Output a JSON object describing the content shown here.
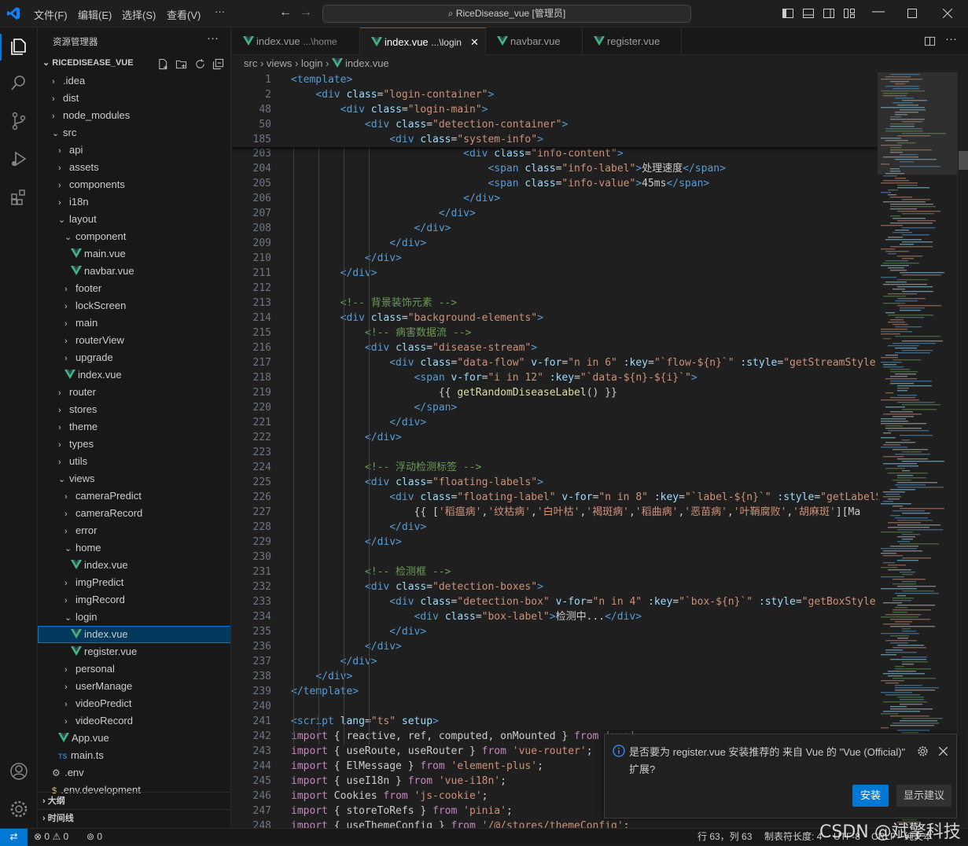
{
  "titlebar": {
    "menus": [
      "文件(F)",
      "编辑(E)",
      "选择(S)",
      "查看(V)",
      "···"
    ],
    "search": "RiceDisease_vue [管理员]"
  },
  "sidebar": {
    "header": "资源管理器",
    "project": "RICEDISEASE_VUE",
    "tree": [
      {
        "label": ".idea",
        "depth": 0,
        "kind": "folder",
        "open": false
      },
      {
        "label": "dist",
        "depth": 0,
        "kind": "folder",
        "open": false
      },
      {
        "label": "node_modules",
        "depth": 0,
        "kind": "folder",
        "open": false
      },
      {
        "label": "src",
        "depth": 0,
        "kind": "folder",
        "open": true
      },
      {
        "label": "api",
        "depth": 1,
        "kind": "folder",
        "open": false
      },
      {
        "label": "assets",
        "depth": 1,
        "kind": "folder",
        "open": false
      },
      {
        "label": "components",
        "depth": 1,
        "kind": "folder",
        "open": false
      },
      {
        "label": "i18n",
        "depth": 1,
        "kind": "folder",
        "open": false
      },
      {
        "label": "layout",
        "depth": 1,
        "kind": "folder",
        "open": true
      },
      {
        "label": "component",
        "depth": 2,
        "kind": "folder",
        "open": true
      },
      {
        "label": "main.vue",
        "depth": 3,
        "kind": "vue"
      },
      {
        "label": "navbar.vue",
        "depth": 3,
        "kind": "vue"
      },
      {
        "label": "footer",
        "depth": 2,
        "kind": "folder",
        "open": false
      },
      {
        "label": "lockScreen",
        "depth": 2,
        "kind": "folder",
        "open": false
      },
      {
        "label": "main",
        "depth": 2,
        "kind": "folder",
        "open": false
      },
      {
        "label": "routerView",
        "depth": 2,
        "kind": "folder",
        "open": false
      },
      {
        "label": "upgrade",
        "depth": 2,
        "kind": "folder",
        "open": false
      },
      {
        "label": "index.vue",
        "depth": 2,
        "kind": "vue"
      },
      {
        "label": "router",
        "depth": 1,
        "kind": "folder",
        "open": false
      },
      {
        "label": "stores",
        "depth": 1,
        "kind": "folder",
        "open": false
      },
      {
        "label": "theme",
        "depth": 1,
        "kind": "folder",
        "open": false
      },
      {
        "label": "types",
        "depth": 1,
        "kind": "folder",
        "open": false
      },
      {
        "label": "utils",
        "depth": 1,
        "kind": "folder",
        "open": false
      },
      {
        "label": "views",
        "depth": 1,
        "kind": "folder",
        "open": true
      },
      {
        "label": "cameraPredict",
        "depth": 2,
        "kind": "folder",
        "open": false
      },
      {
        "label": "cameraRecord",
        "depth": 2,
        "kind": "folder",
        "open": false
      },
      {
        "label": "error",
        "depth": 2,
        "kind": "folder",
        "open": false
      },
      {
        "label": "home",
        "depth": 2,
        "kind": "folder",
        "open": true
      },
      {
        "label": "index.vue",
        "depth": 3,
        "kind": "vue"
      },
      {
        "label": "imgPredict",
        "depth": 2,
        "kind": "folder",
        "open": false
      },
      {
        "label": "imgRecord",
        "depth": 2,
        "kind": "folder",
        "open": false
      },
      {
        "label": "login",
        "depth": 2,
        "kind": "folder",
        "open": true
      },
      {
        "label": "index.vue",
        "depth": 3,
        "kind": "vue",
        "selected": true
      },
      {
        "label": "register.vue",
        "depth": 3,
        "kind": "vue"
      },
      {
        "label": "personal",
        "depth": 2,
        "kind": "folder",
        "open": false
      },
      {
        "label": "userManage",
        "depth": 2,
        "kind": "folder",
        "open": false
      },
      {
        "label": "videoPredict",
        "depth": 2,
        "kind": "folder",
        "open": false
      },
      {
        "label": "videoRecord",
        "depth": 2,
        "kind": "folder",
        "open": false
      },
      {
        "label": "App.vue",
        "depth": 1,
        "kind": "vue"
      },
      {
        "label": "main.ts",
        "depth": 1,
        "kind": "ts"
      },
      {
        "label": ".env",
        "depth": 0,
        "kind": "gear"
      },
      {
        "label": ".env.development",
        "depth": 0,
        "kind": "env"
      }
    ],
    "sections": [
      "大纲",
      "时间线"
    ]
  },
  "tabs": [
    {
      "label": "index.vue",
      "hint": "...\\home",
      "active": false
    },
    {
      "label": "index.vue",
      "hint": "...\\login",
      "active": true
    },
    {
      "label": "navbar.vue",
      "hint": "",
      "active": false
    },
    {
      "label": "register.vue",
      "hint": "",
      "active": false
    }
  ],
  "breadcrumb": [
    "src",
    "views",
    "login",
    "index.vue"
  ],
  "sticky_lines": [
    {
      "n": "1",
      "html": "<span class='tag'>&lt;template&gt;</span>"
    },
    {
      "n": "2",
      "html": "    <span class='tag'>&lt;div</span> <span class='attr'>class</span>=<span class='str'>\"login-container\"</span><span class='tag'>&gt;</span>"
    },
    {
      "n": "48",
      "html": "        <span class='tag'>&lt;div</span> <span class='attr'>class</span>=<span class='str'>\"login-main\"</span><span class='tag'>&gt;</span>"
    },
    {
      "n": "50",
      "html": "            <span class='tag'>&lt;div</span> <span class='attr'>class</span>=<span class='str'>\"detection-container\"</span><span class='tag'>&gt;</span>"
    },
    {
      "n": "185",
      "html": "                <span class='tag'>&lt;div</span> <span class='attr'>class</span>=<span class='str'>\"system-info\"</span><span class='tag'>&gt;</span>"
    }
  ],
  "code_lines": [
    {
      "n": "203",
      "html": "                            <span class='tag'>&lt;div</span> <span class='attr'>class</span>=<span class='str'>\"info-content\"</span><span class='tag'>&gt;</span>"
    },
    {
      "n": "204",
      "html": "                                <span class='tag'>&lt;span</span> <span class='attr'>class</span>=<span class='str'>\"info-label\"</span><span class='tag'>&gt;</span>处理速度<span class='tag'>&lt;/span&gt;</span>"
    },
    {
      "n": "205",
      "html": "                                <span class='tag'>&lt;span</span> <span class='attr'>class</span>=<span class='str'>\"info-value\"</span><span class='tag'>&gt;</span>45ms<span class='tag'>&lt;/span&gt;</span>"
    },
    {
      "n": "206",
      "html": "                            <span class='tag'>&lt;/div&gt;</span>"
    },
    {
      "n": "207",
      "html": "                        <span class='tag'>&lt;/div&gt;</span>"
    },
    {
      "n": "208",
      "html": "                    <span class='tag'>&lt;/div&gt;</span>"
    },
    {
      "n": "209",
      "html": "                <span class='tag'>&lt;/div&gt;</span>"
    },
    {
      "n": "210",
      "html": "            <span class='tag'>&lt;/div&gt;</span>"
    },
    {
      "n": "211",
      "html": "        <span class='tag'>&lt;/div&gt;</span>"
    },
    {
      "n": "212",
      "html": ""
    },
    {
      "n": "213",
      "html": "        <span class='cm'>&lt;!-- 背景装饰元素 --&gt;</span>"
    },
    {
      "n": "214",
      "html": "        <span class='tag'>&lt;div</span> <span class='attr'>class</span>=<span class='str'>\"background-elements\"</span><span class='tag'>&gt;</span>"
    },
    {
      "n": "215",
      "html": "            <span class='cm'>&lt;!-- 病害数据流 --&gt;</span>"
    },
    {
      "n": "216",
      "html": "            <span class='tag'>&lt;div</span> <span class='attr'>class</span>=<span class='str'>\"disease-stream\"</span><span class='tag'>&gt;</span>"
    },
    {
      "n": "217",
      "html": "                <span class='tag'>&lt;div</span> <span class='attr'>class</span>=<span class='str'>\"data-flow\"</span> <span class='attr'>v-for</span>=<span class='str'>\"n in 6\"</span> <span class='attr'>:key</span>=<span class='str'>\"`flow-${n}`\"</span> <span class='attr'>:style</span>=<span class='str'>\"getStreamStyle(n</span>"
    },
    {
      "n": "218",
      "html": "                    <span class='tag'>&lt;span</span> <span class='attr'>v-for</span>=<span class='str'>\"i in 12\"</span> <span class='attr'>:key</span>=<span class='str'>\"`data-${n}-${i}`\"</span><span class='tag'>&gt;</span>"
    },
    {
      "n": "219",
      "html": "                        {{ <span class='fn'>getRandomDiseaseLabel</span>() }}"
    },
    {
      "n": "220",
      "html": "                    <span class='tag'>&lt;/span&gt;</span>"
    },
    {
      "n": "221",
      "html": "                <span class='tag'>&lt;/div&gt;</span>"
    },
    {
      "n": "222",
      "html": "            <span class='tag'>&lt;/div&gt;</span>"
    },
    {
      "n": "223",
      "html": ""
    },
    {
      "n": "224",
      "html": "            <span class='cm'>&lt;!-- 浮动检测标签 --&gt;</span>"
    },
    {
      "n": "225",
      "html": "            <span class='tag'>&lt;div</span> <span class='attr'>class</span>=<span class='str'>\"floating-labels\"</span><span class='tag'>&gt;</span>"
    },
    {
      "n": "226",
      "html": "                <span class='tag'>&lt;div</span> <span class='attr'>class</span>=<span class='str'>\"floating-label\"</span> <span class='attr'>v-for</span>=<span class='str'>\"n in 8\"</span> <span class='attr'>:key</span>=<span class='str'>\"`label-${n}`\"</span> <span class='attr'>:style</span>=<span class='str'>\"getLabelSt</span>"
    },
    {
      "n": "227",
      "html": "                    {{ [<span class='str'>'稻瘟病'</span>,<span class='str'>'纹枯病'</span>,<span class='str'>'白叶枯'</span>,<span class='str'>'褐斑病'</span>,<span class='str'>'稻曲病'</span>,<span class='str'>'恶苗病'</span>,<span class='str'>'叶鞘腐败'</span>,<span class='str'>'胡麻斑'</span>][Ma</span>"
    },
    {
      "n": "228",
      "html": "                <span class='tag'>&lt;/div&gt;</span>"
    },
    {
      "n": "229",
      "html": "            <span class='tag'>&lt;/div&gt;</span>"
    },
    {
      "n": "230",
      "html": ""
    },
    {
      "n": "231",
      "html": "            <span class='cm'>&lt;!-- 检测框 --&gt;</span>"
    },
    {
      "n": "232",
      "html": "            <span class='tag'>&lt;div</span> <span class='attr'>class</span>=<span class='str'>\"detection-boxes\"</span><span class='tag'>&gt;</span>"
    },
    {
      "n": "233",
      "html": "                <span class='tag'>&lt;div</span> <span class='attr'>class</span>=<span class='str'>\"detection-box\"</span> <span class='attr'>v-for</span>=<span class='str'>\"n in 4\"</span> <span class='attr'>:key</span>=<span class='str'>\"`box-${n}`\"</span> <span class='attr'>:style</span>=<span class='str'>\"getBoxStyle(n</span>"
    },
    {
      "n": "234",
      "html": "                    <span class='tag'>&lt;div</span> <span class='attr'>class</span>=<span class='str'>\"box-label\"</span><span class='tag'>&gt;</span>检测中...<span class='tag'>&lt;/div&gt;</span>"
    },
    {
      "n": "235",
      "html": "                <span class='tag'>&lt;/div&gt;</span>"
    },
    {
      "n": "236",
      "html": "            <span class='tag'>&lt;/div&gt;</span>"
    },
    {
      "n": "237",
      "html": "        <span class='tag'>&lt;/div&gt;</span>"
    },
    {
      "n": "238",
      "html": "    <span class='tag'>&lt;/div&gt;</span>"
    },
    {
      "n": "239",
      "html": "<span class='tag'>&lt;/template&gt;</span>"
    },
    {
      "n": "240",
      "html": ""
    },
    {
      "n": "241",
      "html": "<span class='tag'>&lt;script</span> <span class='attr'>lang</span>=<span class='str'>\"ts\"</span> <span class='attr'>setup</span><span class='tag'>&gt;</span>"
    },
    {
      "n": "242",
      "html": "<span class='kw'>import</span> { reactive, ref, computed, onMounted } <span class='kw'>from</span> <span class='str'>'vue'</span>;"
    },
    {
      "n": "243",
      "html": "<span class='kw'>import</span> { useRoute, useRouter } <span class='kw'>from</span> <span class='str'>'vue-router'</span>;"
    },
    {
      "n": "244",
      "html": "<span class='kw'>import</span> { ElMessage } <span class='kw'>from</span> <span class='str'>'element-plus'</span>;"
    },
    {
      "n": "245",
      "html": "<span class='kw'>import</span> { useI18n } <span class='kw'>from</span> <span class='str'>'vue-i18n'</span>;"
    },
    {
      "n": "246",
      "html": "<span class='kw'>import</span> Cookies <span class='kw'>from</span> <span class='str'>'js-cookie'</span>;"
    },
    {
      "n": "247",
      "html": "<span class='kw'>import</span> { storeToRefs } <span class='kw'>from</span> <span class='str'>'pinia'</span>;"
    },
    {
      "n": "248",
      "html": "<span class='kw'>import</span> { useThemeConfig } <span class='kw'>from</span> <span class='str'>'/@/stores/themeConfig'</span>;"
    }
  ],
  "notification": {
    "message": "是否要为 register.vue 安装推荐的 来自 Vue 的 \"Vue (Official)\" 扩展?",
    "install": "安装",
    "show": "显示建议"
  },
  "statusbar": {
    "errors": "0",
    "warnings": "0",
    "ports": "0",
    "position": "行 63，列 63",
    "tabsize": "制表符长度: 4",
    "encoding": "UTF-8",
    "eol": "CRLF",
    "lang": "纯文本"
  },
  "watermark": "CSDN @斌擎科技",
  "colors": {
    "accent": "#0078d4",
    "vue": "#41b883"
  }
}
